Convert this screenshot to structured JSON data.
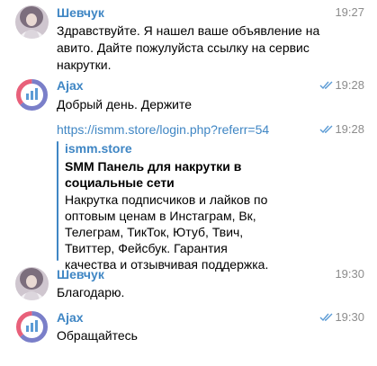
{
  "messages": [
    {
      "sender": "Шевчук",
      "time": "19:27",
      "text": "Здравствуйте. Я нашел ваше объявление на авито. Дайте пожулуйста ссылку на сервис накрутки."
    },
    {
      "sender": "Ajax",
      "time": "19:28",
      "text": "Добрый день. Держите"
    },
    {
      "time": "19:28",
      "link": "https://ismm.store/login.php?referr=54",
      "preview": {
        "site": "ismm.store",
        "title": "SMM Панель для накрутки в социальные сети",
        "description": "Накрутка подписчиков и лайков по оптовым ценам в Инстаграм, Вк, Телеграм, ТикТок, Ютуб, Твич, Твиттер, Фейсбук. Гарантия качества и отзывчивая поддержка."
      }
    },
    {
      "sender": "Шевчук",
      "time": "19:30",
      "text": "Благодарю."
    },
    {
      "sender": "Ajax",
      "time": "19:30",
      "text": "Обращайтесь"
    }
  ],
  "colors": {
    "link": "#3f86c4",
    "time": "#8c8c8c",
    "read_checks": "#5b9bd5"
  },
  "icons": {
    "shevchuk_avatar": "user-photo-avatar",
    "ajax_avatar": "chart-logo-avatar",
    "read_status": "double-check-icon"
  }
}
